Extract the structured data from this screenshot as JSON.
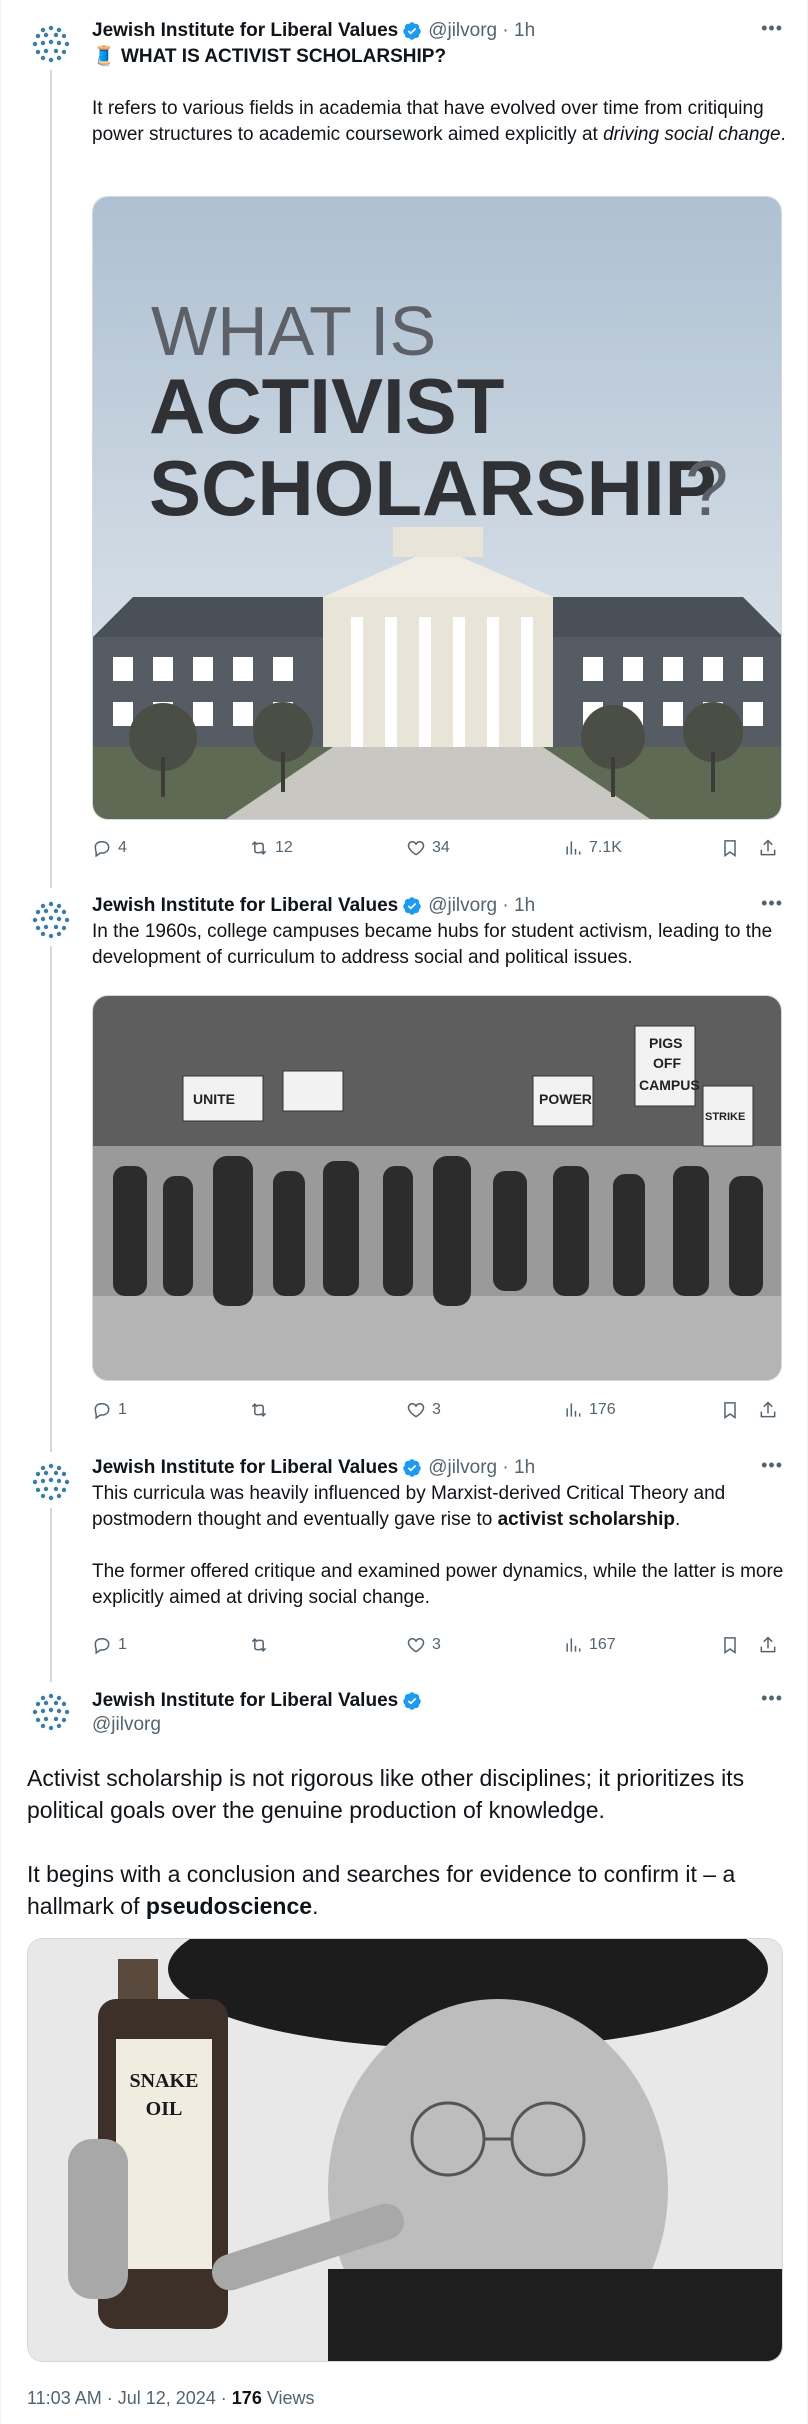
{
  "colors": {
    "accent": "#1d9bf0",
    "text": "#0f1419",
    "muted": "#536471",
    "line": "#cfd9de"
  },
  "author": {
    "name": "Jewish Institute for Liberal Values",
    "handle": "@jilvorg"
  },
  "tweets": [
    {
      "meta": "@jilvorg · 1h",
      "title_emoji": "🧵",
      "title": "WHAT IS ACTIVIST SCHOLARSHIP?",
      "text_main": "It refers to various fields in academia that have evolved over time from critiquing power structures to academic coursework aimed explicitly at",
      "text_italic": "driving social change",
      "text_end": ".",
      "image": {
        "line1": "WHAT IS",
        "line2": "ACTIVIST",
        "line3": "SCHOLARSHIP",
        "qmark": "?"
      },
      "stats": {
        "replies": "4",
        "reposts": "12",
        "likes": "34",
        "views": "7.1K"
      }
    },
    {
      "meta": "@jilvorg · 1h",
      "text": "In the 1960s, college campuses became hubs for student activism, leading to the development of curriculum to address social and political issues.",
      "image": {
        "sign1": "PIGS",
        "sign2": "OFF",
        "sign3": "CAMPUS",
        "sign4": "POWER",
        "sign5": "UNITE",
        "sign6": "STRIKE"
      },
      "stats": {
        "replies": "1",
        "reposts": "",
        "likes": "3",
        "views": "176"
      }
    },
    {
      "meta": "@jilvorg · 1h",
      "text_a": "This curricula was heavily influenced by Marxist-derived Critical Theory and postmodern thought and eventually gave rise to",
      "text_bold": "activist scholarship",
      "text_a_end": ".",
      "text_b": "The former offered critique and examined power dynamics, while the latter is more explicitly aimed at driving social change.",
      "stats": {
        "replies": "1",
        "reposts": "",
        "likes": "3",
        "views": "167"
      }
    },
    {
      "handle": "@jilvorg",
      "text_a": "Activist scholarship is not rigorous like other disciplines; it prioritizes its political goals over the genuine production of knowledge.",
      "text_b": "It begins with a conclusion and searches for evidence to confirm it – a hallmark of",
      "text_bold": "pseudoscience",
      "text_b_end": ".",
      "image": {
        "label1": "SNAKE",
        "label2": "OIL"
      },
      "footer": {
        "time": "11:03 AM · Jul 12, 2024 · ",
        "views_count": "176",
        "views_label": " Views"
      }
    }
  ]
}
